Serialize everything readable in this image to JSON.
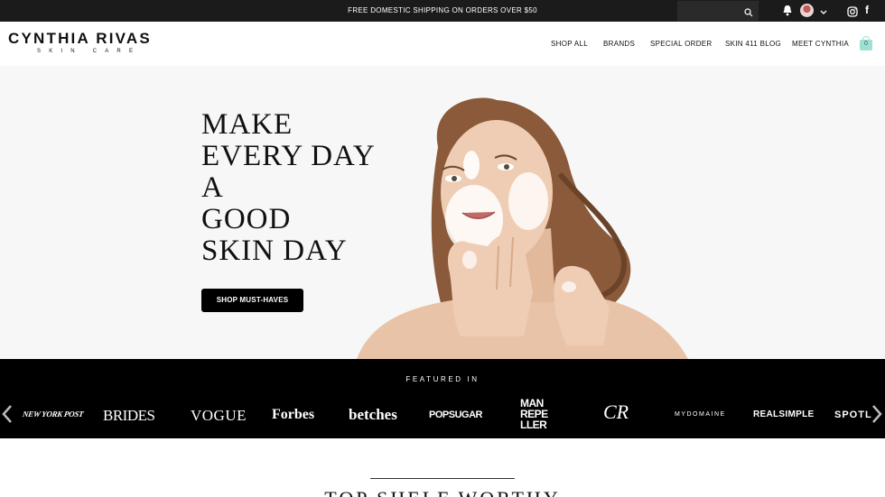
{
  "topbar": {
    "promo": "FREE DOMESTIC SHIPPING ON ORDERS OVER $50",
    "icons": [
      "search-icon",
      "bell-icon",
      "avatar",
      "chevron-down-icon",
      "instagram-icon",
      "facebook-icon"
    ],
    "facebook_glyph": "f"
  },
  "header": {
    "brand": "CYNTHIA RIVAS",
    "brand_sub": "SKIN CARE",
    "nav": [
      "SHOP ALL",
      "BRANDS",
      "SPECIAL ORDER",
      "SKIN 411 BLOG",
      "MEET CYNTHIA"
    ],
    "cart_count": "0",
    "cart_color": "#9fe0d2"
  },
  "hero": {
    "headline_lines": [
      "MAKE",
      "EVERY DAY",
      "A",
      "GOOD",
      "SKIN DAY"
    ],
    "cta": "SHOP MUST-HAVES"
  },
  "featured": {
    "label": "FEATURED IN",
    "logos": [
      "NEW YORK POST",
      "BRIDES",
      "VOGUE",
      "Forbes",
      "betches",
      "POPSUGAR",
      "MAN REPE LLER",
      "CR",
      "MYDOMAINE",
      "REALSIMPLE",
      "SPOTL"
    ]
  },
  "section": {
    "title": "TOP SHELF WORTHY"
  },
  "colors": {
    "topbar_bg": "#1b1b1b",
    "hero_bg": "#f7f7f7",
    "featured_bg": "#000000",
    "accent": "#9fe0d2"
  }
}
